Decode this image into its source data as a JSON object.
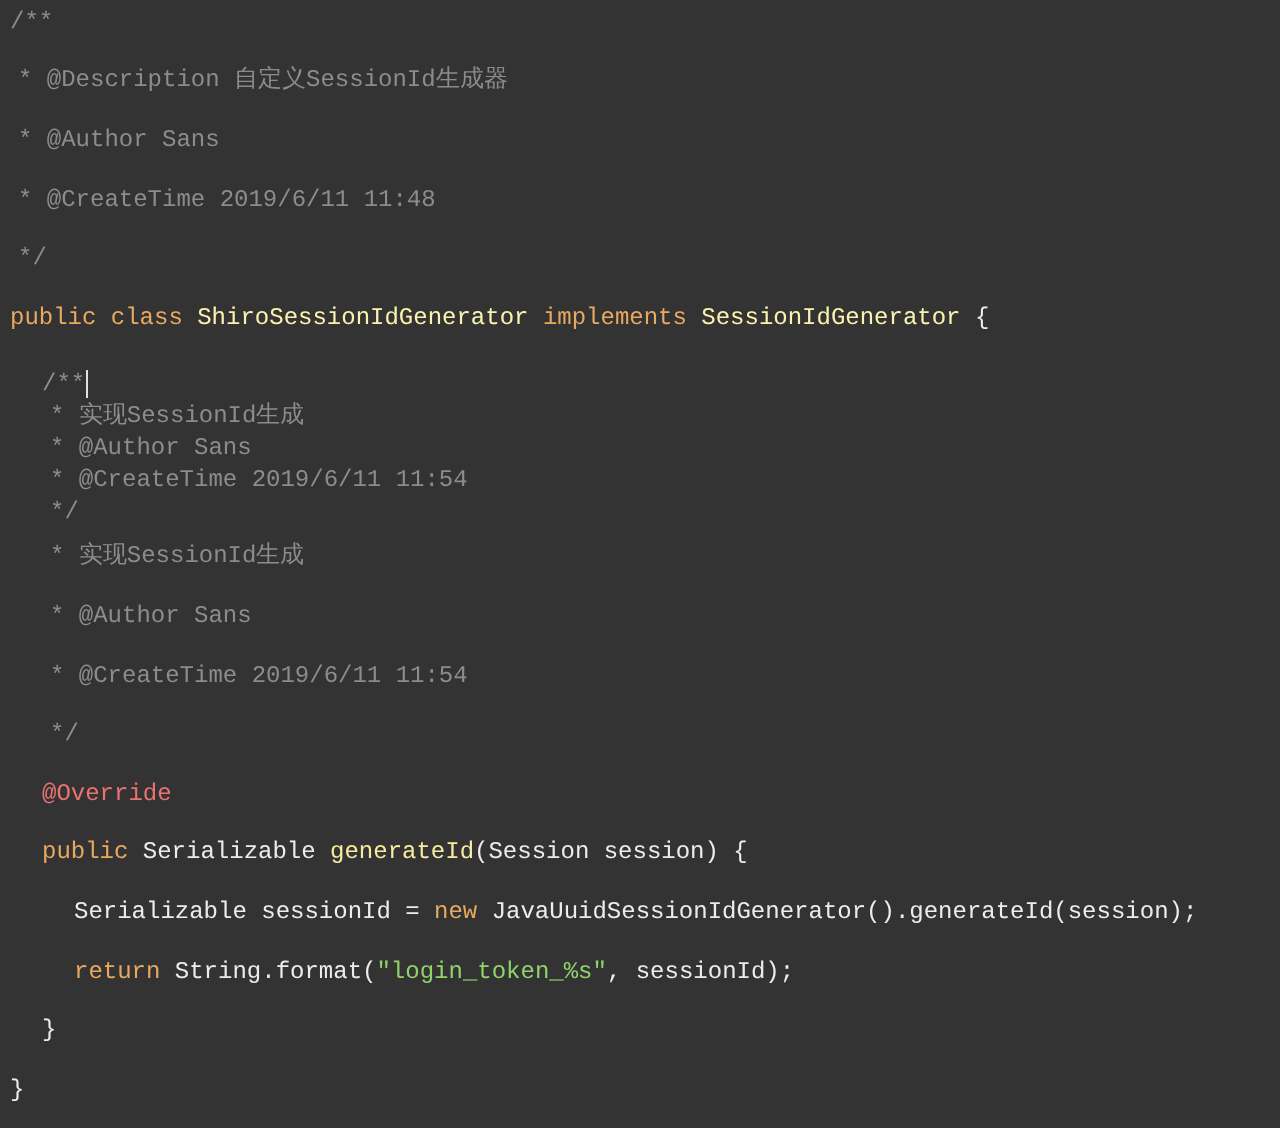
{
  "editor": {
    "blocks": [
      {
        "kind": "spaced",
        "lines": [
          {
            "kind": "top",
            "tokens": [
              {
                "kind": "comment",
                "text": "/**"
              }
            ]
          },
          {
            "kind": "topdoc",
            "tokens": [
              {
                "kind": "comment",
                "text": "* @Description 自定义SessionId生成器"
              }
            ]
          },
          {
            "kind": "topdoc",
            "tokens": [
              {
                "kind": "comment",
                "text": "* @Author Sans"
              }
            ]
          },
          {
            "kind": "topdoc",
            "tokens": [
              {
                "kind": "comment",
                "text": "* @CreateTime 2019/6/11 11:48"
              }
            ]
          },
          {
            "kind": "topdoc",
            "tokens": [
              {
                "kind": "comment",
                "text": "*/"
              }
            ]
          },
          {
            "kind": "top",
            "tokens": [
              {
                "kind": "keyword",
                "text": "public class"
              },
              {
                "kind": "gap"
              },
              {
                "kind": "type",
                "text": "ShiroSessionIdGenerator"
              },
              {
                "kind": "gap"
              },
              {
                "kind": "keyword",
                "text": "implements"
              },
              {
                "kind": "gap"
              },
              {
                "kind": "type",
                "text": "SessionIdGenerator"
              },
              {
                "kind": "gap"
              },
              {
                "kind": "plain",
                "text": "{"
              }
            ]
          }
        ]
      },
      {
        "kind": "compact",
        "lines": [
          {
            "kind": "member",
            "tokens": [
              {
                "kind": "comment",
                "text": "/**"
              },
              {
                "kind": "caret"
              }
            ]
          },
          {
            "kind": "memberdoc",
            "tokens": [
              {
                "kind": "comment",
                "text": "* 实现SessionId生成"
              }
            ]
          },
          {
            "kind": "memberdoc",
            "tokens": [
              {
                "kind": "comment",
                "text": "* @Author Sans"
              }
            ]
          },
          {
            "kind": "memberdoc",
            "tokens": [
              {
                "kind": "comment",
                "text": "* @CreateTime 2019/6/11 11:54"
              }
            ]
          },
          {
            "kind": "memberdoc",
            "tokens": [
              {
                "kind": "comment",
                "text": "*/"
              }
            ]
          }
        ]
      },
      {
        "kind": "spaced",
        "lines": [
          {
            "kind": "memberdoc",
            "tokens": [
              {
                "kind": "comment",
                "text": "* 实现SessionId生成"
              }
            ]
          },
          {
            "kind": "memberdoc",
            "tokens": [
              {
                "kind": "comment",
                "text": "* @Author Sans"
              }
            ]
          },
          {
            "kind": "memberdoc",
            "tokens": [
              {
                "kind": "comment",
                "text": "* @CreateTime 2019/6/11 11:54"
              }
            ]
          },
          {
            "kind": "memberdoc",
            "tokens": [
              {
                "kind": "comment",
                "text": "*/"
              }
            ]
          },
          {
            "kind": "member",
            "tokens": [
              {
                "kind": "annotation",
                "text": "@Override"
              }
            ]
          },
          {
            "kind": "member",
            "tokens": [
              {
                "kind": "keyword",
                "text": "public"
              },
              {
                "kind": "gap"
              },
              {
                "kind": "plain",
                "text": "Serializable"
              },
              {
                "kind": "gap"
              },
              {
                "kind": "method",
                "text": "generateId"
              },
              {
                "kind": "plain",
                "text": "(Session session) {"
              }
            ]
          },
          {
            "kind": "body",
            "tokens": [
              {
                "kind": "plain",
                "text": "Serializable sessionId ="
              },
              {
                "kind": "gap"
              },
              {
                "kind": "keyword",
                "text": "new"
              },
              {
                "kind": "gap"
              },
              {
                "kind": "plain",
                "text": "JavaUuidSessionIdGenerator().generateId(session);"
              }
            ]
          },
          {
            "kind": "body",
            "tokens": [
              {
                "kind": "keyword",
                "text": "return"
              },
              {
                "kind": "gap"
              },
              {
                "kind": "plain",
                "text": "String.format("
              },
              {
                "kind": "string",
                "text": "\"login_token_%s\""
              },
              {
                "kind": "plain",
                "text": ", sessionId);"
              }
            ]
          },
          {
            "kind": "member",
            "tokens": [
              {
                "kind": "plain",
                "text": "}"
              }
            ]
          },
          {
            "kind": "top",
            "tokens": [
              {
                "kind": "plain",
                "text": "}"
              }
            ]
          }
        ]
      }
    ]
  }
}
